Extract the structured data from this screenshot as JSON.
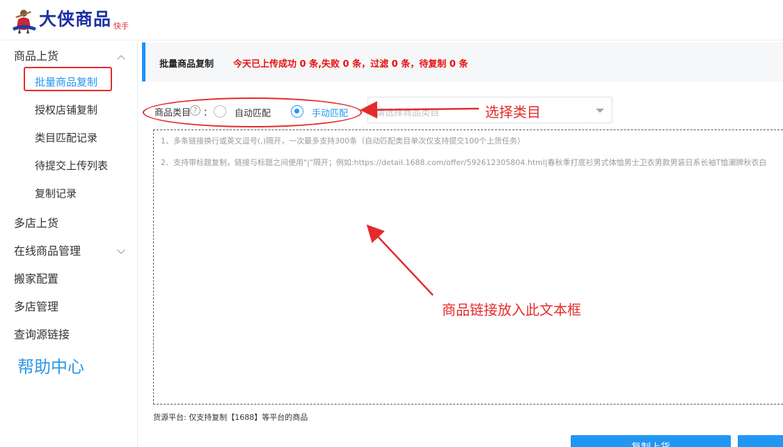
{
  "app": {
    "logo_title": "大侠商品",
    "logo_sub": "快手"
  },
  "sidebar": {
    "items": [
      {
        "label": "商品上货"
      },
      {
        "label": "批量商品复制"
      },
      {
        "label": "授权店铺复制"
      },
      {
        "label": "类目匹配记录"
      },
      {
        "label": "待提交上传列表"
      },
      {
        "label": "复制记录"
      },
      {
        "label": "多店上货"
      },
      {
        "label": "在线商品管理"
      },
      {
        "label": "搬家配置"
      },
      {
        "label": "多店管理"
      },
      {
        "label": "查询源链接"
      }
    ],
    "help": "帮助中心"
  },
  "notice": {
    "title": "批量商品复制",
    "stats": "今天已上传成功 0 条,失败 0 条，过滤 0 条，待复制 0 条"
  },
  "category": {
    "label": "商品类目",
    "help_glyph": "?",
    "colon": "：",
    "auto_label": "自动匹配",
    "manual_label": "手动匹配",
    "select_placeholder": "请选择商品类目",
    "selected_mode": "manual"
  },
  "link_box": {
    "hint1": "1、多条链接换行或英文逗号(,)隔开，一次最多支持300条（自动匹配类目单次仅支持提交100个上货任务）",
    "hint2": "2、支持带标题复制，链接与标题之间使用\"|\"隔开；例如:https://detail.1688.com/offer/592612305804.html|春秋季打底衫男式体恤男士卫衣男款男装日系长袖T恤潮牌秋衣白"
  },
  "source_note": "货源平台:  仅支持复制【1688】等平台的商品",
  "buttons": {
    "primary": "复制上货",
    "secondary": ""
  },
  "annotations": {
    "choose_category": "选择类目",
    "paste_links": "商品链接放入此文本框",
    "color": "#e42b2b"
  },
  "colors": {
    "accent": "#2196f3",
    "stat_red": "#e8110e",
    "logo_blue": "#1d2fa3"
  }
}
